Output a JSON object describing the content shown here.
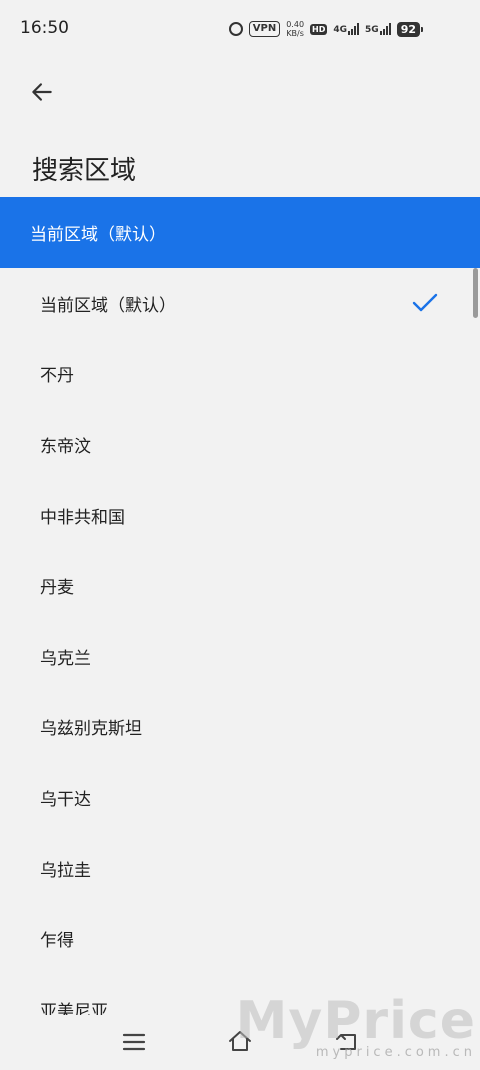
{
  "status_bar": {
    "time": "16:50",
    "vpn": "VPN",
    "speed_value": "0.40",
    "speed_unit": "KB/s",
    "hd": "HD",
    "net1": "4G",
    "net2": "5G",
    "battery": "92"
  },
  "header": {
    "back_icon": "arrow-left-icon",
    "title": "搜索区域"
  },
  "selected_banner": {
    "label": "当前区域（默认）",
    "color": "#1a73e8"
  },
  "regions": [
    {
      "label": "当前区域（默认）",
      "checked": true
    },
    {
      "label": "不丹",
      "checked": false
    },
    {
      "label": "东帝汶",
      "checked": false
    },
    {
      "label": "中非共和国",
      "checked": false
    },
    {
      "label": "丹麦",
      "checked": false
    },
    {
      "label": "乌克兰",
      "checked": false
    },
    {
      "label": "乌兹别克斯坦",
      "checked": false
    },
    {
      "label": "乌干达",
      "checked": false
    },
    {
      "label": "乌拉圭",
      "checked": false
    },
    {
      "label": "乍得",
      "checked": false
    },
    {
      "label": "亚美尼亚",
      "checked": false
    }
  ],
  "nav_bar": {
    "menu_icon": "menu-icon",
    "home_icon": "home-icon",
    "back_icon": "back-icon"
  },
  "watermark": {
    "logo": "MyPrice",
    "url": "myprice.com.cn"
  }
}
